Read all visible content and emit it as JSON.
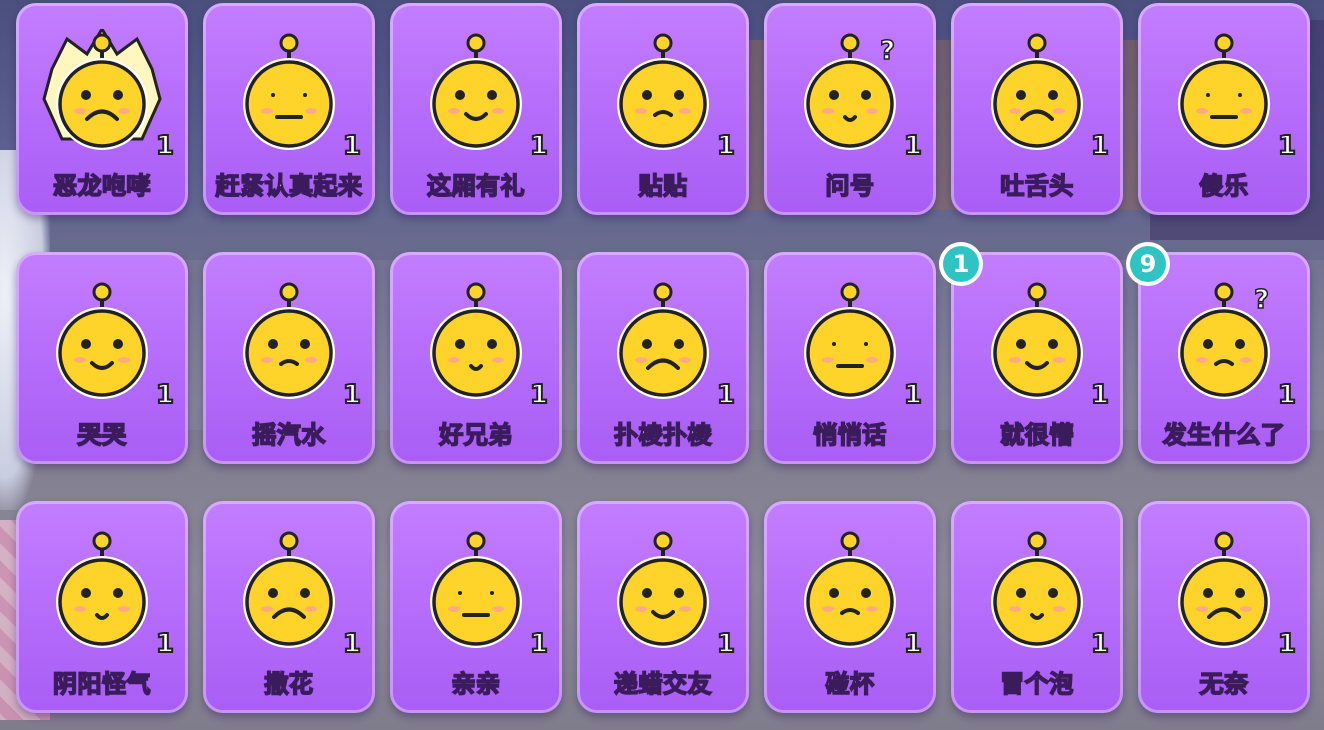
{
  "emotes": [
    {
      "label": "恶龙咆哮",
      "count": "1",
      "icon": "angry-roar-icon"
    },
    {
      "label": "赶紧认真起来",
      "count": "1",
      "icon": "serious-face-icon"
    },
    {
      "label": "这厢有礼",
      "count": "1",
      "icon": "gentleman-fan-icon"
    },
    {
      "label": "贴贴",
      "count": "1",
      "icon": "cuddle-icon"
    },
    {
      "label": "问号",
      "count": "1",
      "icon": "question-mark-icon"
    },
    {
      "label": "吐舌头",
      "count": "1",
      "icon": "tongue-out-icon"
    },
    {
      "label": "傻乐",
      "count": "1",
      "icon": "silly-laugh-icon"
    },
    {
      "label": "哭哭",
      "count": "1",
      "icon": "crying-girl-icon"
    },
    {
      "label": "摇汽水",
      "count": "1",
      "icon": "shake-soda-icon"
    },
    {
      "label": "好兄弟",
      "count": "1",
      "icon": "bear-brothers-icon"
    },
    {
      "label": "扑棱扑棱",
      "count": "1",
      "icon": "flapping-bird-icon"
    },
    {
      "label": "悄悄话",
      "count": "1",
      "icon": "whisper-icon"
    },
    {
      "label": "就很懵",
      "count": "1",
      "icon": "confused-icon",
      "badge": "1"
    },
    {
      "label": "发生什么了",
      "count": "1",
      "icon": "bunny-girl-question-icon",
      "badge": "9"
    },
    {
      "label": "阴阳怪气",
      "count": "1",
      "icon": "sarcastic-pig-icon"
    },
    {
      "label": "撒花",
      "count": "1",
      "icon": "throw-flowers-icon"
    },
    {
      "label": "亲亲",
      "count": "1",
      "icon": "kiss-icon"
    },
    {
      "label": "递蜡交友",
      "count": "1",
      "icon": "candle-friend-icon"
    },
    {
      "label": "碰杯",
      "count": "1",
      "icon": "cheers-icon"
    },
    {
      "label": "冒个泡",
      "count": "1",
      "icon": "bubble-up-icon"
    },
    {
      "label": "无奈",
      "count": "1",
      "icon": "helpless-icon"
    }
  ],
  "colors": {
    "card": "#b46bfa",
    "face": "#ffd42a",
    "badge": "#2fc4c4"
  }
}
